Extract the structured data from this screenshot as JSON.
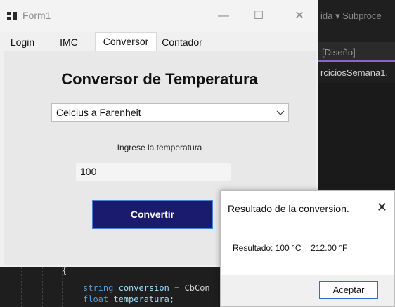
{
  "ide": {
    "top_menu": "ida ▾ Subproce",
    "designer_tab": "[Diseño]",
    "solution_item": "rciciosSemana1.",
    "code_lines": [
      {
        "open_brace": "{"
      },
      {
        "type_kw": "string",
        "name": "conversion",
        "rest": " = CbCon"
      },
      {
        "type_kw": "float",
        "name": "temperatura",
        "rest": ";"
      }
    ]
  },
  "window": {
    "title": "Form1",
    "minimize_glyph": "—",
    "maximize_glyph": "☐",
    "close_glyph": "✕"
  },
  "tabs": [
    {
      "label": "Login",
      "active": false
    },
    {
      "label": "IMC",
      "active": false
    },
    {
      "label": "Conversor",
      "active": true
    },
    {
      "label": "Contador",
      "active": false
    }
  ],
  "converter": {
    "heading": "Conversor de Temperatura",
    "mode_selected": "Celcius a Farenheit",
    "prompt": "Ingrese la temperatura",
    "input_value": "100",
    "convert_button": "Convertir"
  },
  "dialog": {
    "title": "Resultado de la conversion.",
    "close_glyph": "✕",
    "message": "Resultado: 100 °C = 212.00 °F",
    "ok_button": "Aceptar"
  },
  "colors": {
    "convert_button_bg": "#1a1a6e",
    "focus_border": "#4a7fd6",
    "ide_accent": "#8a63d2"
  }
}
